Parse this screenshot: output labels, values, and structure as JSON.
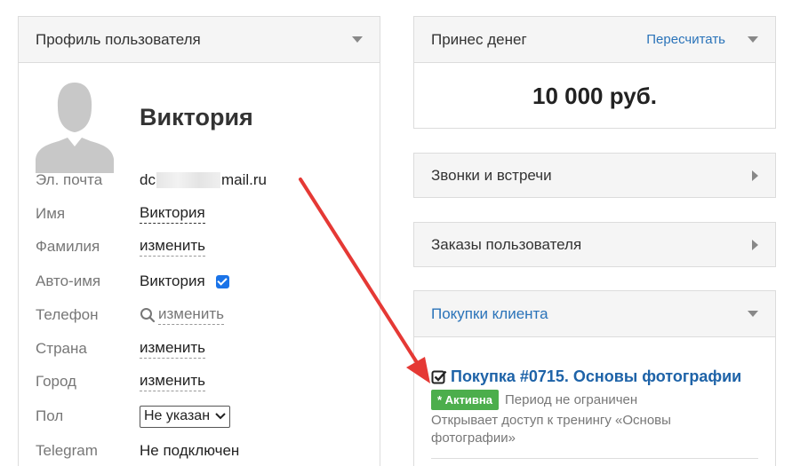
{
  "profile": {
    "title": "Профиль пользователя",
    "name": "Виктория",
    "fields": {
      "email_label": "Эл. почта",
      "email_prefix": "dc",
      "email_suffix": "mail.ru",
      "first_name_label": "Имя",
      "first_name_value": "Виктория",
      "last_name_label": "Фамилия",
      "last_name_action": "изменить",
      "auto_name_label": "Авто-имя",
      "auto_name_value": "Виктория",
      "phone_label": "Телефон",
      "phone_action": "изменить",
      "country_label": "Страна",
      "country_action": "изменить",
      "city_label": "Город",
      "city_action": "изменить",
      "gender_label": "Пол",
      "gender_value": "Не указан",
      "telegram_label": "Telegram",
      "telegram_value": "Не подключен"
    }
  },
  "money": {
    "title": "Принес денег",
    "recalc_label": "Пересчитать",
    "amount": "10 000 руб."
  },
  "calls": {
    "title": "Звонки и встречи"
  },
  "orders": {
    "title": "Заказы пользователя"
  },
  "purchases": {
    "title": "Покупки клиента",
    "item": {
      "title": "Покупка #0715. Основы фотографии",
      "status": "* Активна",
      "period": "Период не ограничен",
      "description": "Открывает доступ к тренингу «Основы фотографии»"
    }
  },
  "colors": {
    "link": "#2a73b9",
    "badge": "#4cae4c",
    "arrow": "#e53935",
    "checkbox": "#1a73e8"
  }
}
